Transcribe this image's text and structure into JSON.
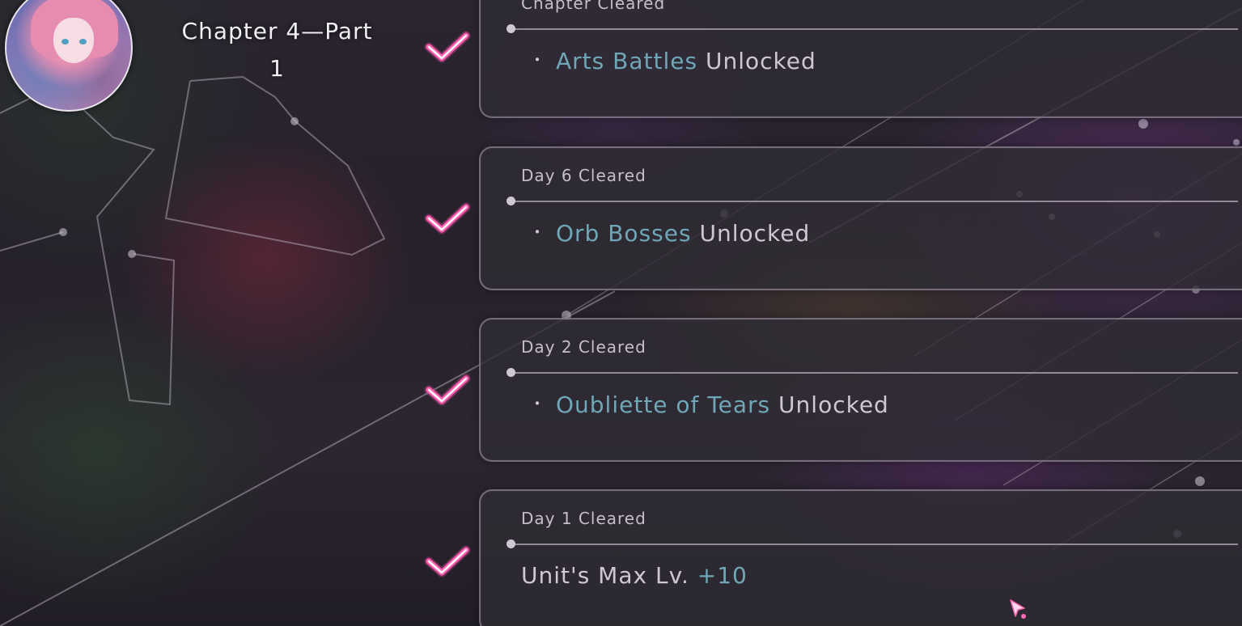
{
  "header": {
    "chapter_title_line1": "Chapter 4—Part",
    "chapter_title_line2": "1"
  },
  "rewards": [
    {
      "label": "Chapter Cleared",
      "highlight": "Arts Battles",
      "suffix": " Unlocked",
      "bulleted": true
    },
    {
      "label": "Day 6 Cleared",
      "highlight": "Orb Bosses",
      "suffix": " Unlocked",
      "bulleted": true
    },
    {
      "label": "Day 2 Cleared",
      "highlight": "Oubliette of Tears",
      "suffix": " Unlocked",
      "bulleted": true
    },
    {
      "label": "Day 1 Cleared",
      "prefix": "Unit's Max Lv. ",
      "highlight": "+10",
      "bulleted": false
    }
  ],
  "icons": {
    "check": "check-mark-icon",
    "cursor": "pointer-cursor-icon",
    "bullet": "・"
  },
  "colors": {
    "check_pink": "#ff4fa8",
    "highlight_teal": "#6fa7b6",
    "text_light": "#cdc8d2"
  }
}
